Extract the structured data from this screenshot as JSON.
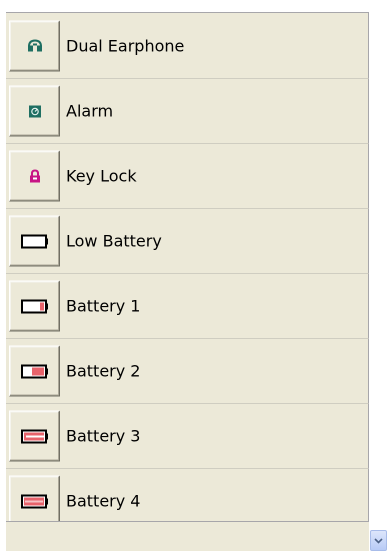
{
  "list": {
    "items": [
      {
        "label": "Dual Earphone",
        "icon": "earphone-icon"
      },
      {
        "label": "Alarm",
        "icon": "alarm-icon"
      },
      {
        "label": "Key Lock",
        "icon": "lock-icon"
      },
      {
        "label": "Low Battery",
        "icon": "battery-empty-icon"
      },
      {
        "label": "Battery 1",
        "icon": "battery-1-icon"
      },
      {
        "label": "Battery 2",
        "icon": "battery-2-icon"
      },
      {
        "label": "Battery 3",
        "icon": "battery-3-icon"
      },
      {
        "label": "Battery 4",
        "icon": "battery-4-icon"
      }
    ]
  },
  "colors": {
    "panel_bg": "#ece9d8",
    "earphone": "#1f6f62",
    "alarm": "#1f6f62",
    "lock": "#c71585",
    "battery_fill": "#e8636b",
    "battery_outline": "#000000"
  },
  "scrollbar": {
    "icon": "chevron-down-icon"
  }
}
